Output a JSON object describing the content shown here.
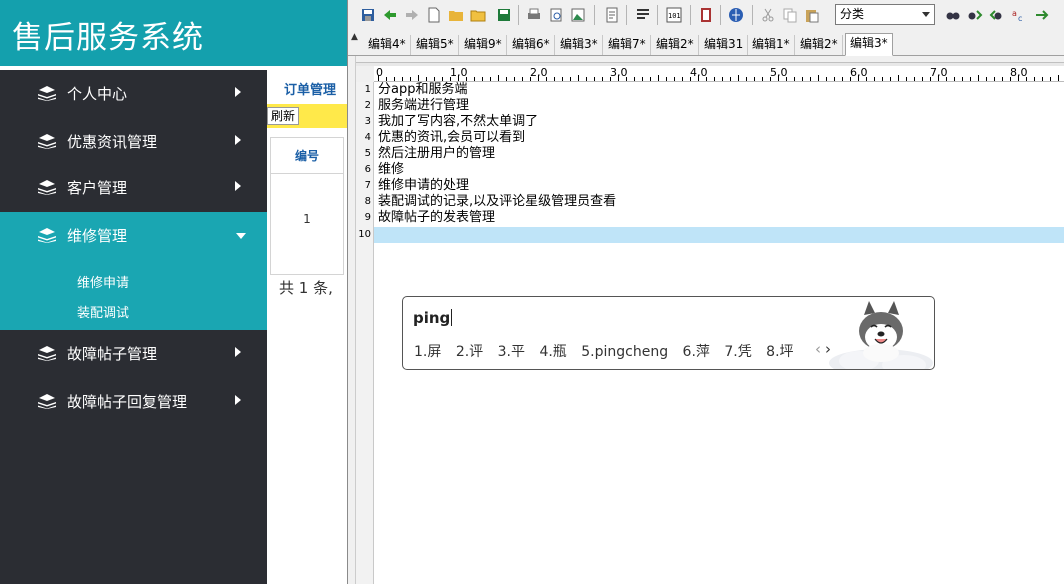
{
  "app": {
    "title": "售后服务系统",
    "sidebar": [
      {
        "label": "个人中心",
        "active": false
      },
      {
        "label": "优惠资讯管理",
        "active": false
      },
      {
        "label": "客户管理",
        "active": false
      },
      {
        "label": "维修管理",
        "active": true
      },
      {
        "label": "故障帖子管理",
        "active": false
      },
      {
        "label": "故障帖子回复管理",
        "active": false
      }
    ],
    "submenu": [
      "维修申请",
      "装配调试"
    ],
    "content": {
      "section_title": "订单管理",
      "refresh_label": "刷新",
      "table_header": "编号",
      "table_cell": "1",
      "total": "共 1 条,"
    }
  },
  "editor": {
    "category_select": "分类",
    "tabs": [
      {
        "label": "编辑4*",
        "active": false
      },
      {
        "label": "编辑5*",
        "active": false
      },
      {
        "label": "编辑9*",
        "active": false
      },
      {
        "label": "编辑6*",
        "active": false
      },
      {
        "label": "编辑3*",
        "active": false
      },
      {
        "label": "编辑7*",
        "active": false
      },
      {
        "label": "编辑2*",
        "active": false
      },
      {
        "label": "编辑31",
        "active": false
      },
      {
        "label": "编辑1*",
        "active": false
      },
      {
        "label": "编辑2*",
        "active": false
      },
      {
        "label": "编辑3*",
        "active": true
      }
    ],
    "ruler_labels": [
      "0",
      "1,0",
      "2,0",
      "3,0",
      "4,0",
      "5,0",
      "6,0",
      "7,0",
      "8,0"
    ],
    "line_numbers": [
      "1",
      "2",
      "3",
      "4",
      "5",
      "6",
      "7",
      "8",
      "9",
      "10"
    ],
    "lines": [
      "分app和服务端",
      "服务端进行管理",
      "我加了写内容,不然太单调了",
      "优惠的资讯,会员可以看到",
      "然后注册用户的管理",
      "维修",
      "维修申请的处理",
      "装配调试的记录,以及评论星级管理员查看",
      "故障帖子的发表管理",
      ""
    ]
  },
  "ime": {
    "input": "ping",
    "candidates": [
      "1.屏",
      "2.评",
      "3.平",
      "4.瓶",
      "5.pingcheng",
      "6.萍",
      "7.凭",
      "8.坪"
    ],
    "prev": "‹",
    "next": "›"
  },
  "colors": {
    "header_teal": "#14a0ad",
    "active_teal": "#1aa6b2",
    "sidebar_dark": "#2b2d33",
    "link_blue": "#1b5fa6",
    "highlight_line": "#bfe4f8",
    "yellow_bar": "#ffe94a"
  }
}
